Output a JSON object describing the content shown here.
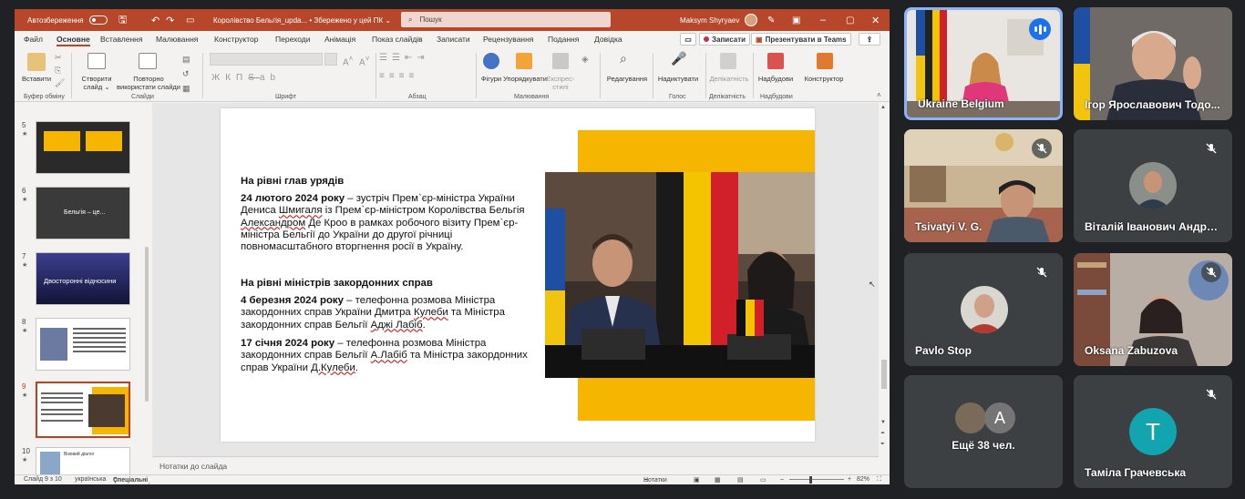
{
  "titlebar": {
    "autosave_label": "Автозбереження",
    "doc_title": "Королівство Бельгія_upda... • Збережено у цей ПК ⌄",
    "search_placeholder": "Пошук",
    "user_name": "Maksym Shyryaev"
  },
  "menu": {
    "tabs": [
      "Файл",
      "Основне",
      "Вставлення",
      "Малювання",
      "Конструктор",
      "Переходи",
      "Анімація",
      "Показ слайдів",
      "Записати",
      "Рецензування",
      "Подання",
      "Довідка"
    ],
    "active_tab": "Основне",
    "record_button": "Записати",
    "teams_button": "Презентувати в Teams"
  },
  "ribbon": {
    "paste": "Вставити",
    "new_slide": "Створити слайд ⌄",
    "reuse_slides": "Повторно використати слайди",
    "shapes": "Фігури",
    "arrange": "Упорядкувати",
    "quick_styles": "Експрес-стилі",
    "editing": "Редагування",
    "dictate": "Надиктувати",
    "sensitivity": "Делікатність",
    "add_ins": "Надбудови",
    "designer": "Конструктор",
    "groups": [
      "Буфер обміну",
      "Слайди",
      "Шрифт",
      "Абзац",
      "Малювання",
      "Голос",
      "Делікатність",
      "Надбудови"
    ]
  },
  "thumbnails": [
    {
      "num": "5",
      "star": "★"
    },
    {
      "num": "6",
      "star": "★",
      "caption": "Бельгія – це..."
    },
    {
      "num": "7",
      "star": "★",
      "caption": "Двосторонні відносини"
    },
    {
      "num": "8",
      "star": "★"
    },
    {
      "num": "9",
      "star": "★"
    },
    {
      "num": "10",
      "star": "★",
      "caption": "Візовий діалог"
    }
  ],
  "slide": {
    "heading1": "На рівні глав урядів",
    "para1_bold": "24 лютого 2024 року",
    "para1_a": " – зустріч Прем`єр-міністра України ",
    "para1_b": "Дениса ",
    "para1_c": "Шмигаля",
    "para1_d": " із Прем`єр-міністром Королівства Бельгія ",
    "para1_e": "Александром",
    "para1_f": " Де Кроо в рамках робочого візиту Прем`єр-міністра Бельгії до України до другої річниці повномасштабного вторгнення росії в Україну.",
    "heading2": "На рівні міністрів закордонних справ",
    "para2_bold": "4 березня 2024 року",
    "para2_a": " – телефонна розмова Міністра закордонних справ України Дмитра ",
    "para2_b": "Кулеби",
    "para2_c": " та Міністра закордонних справ Бельгії ",
    "para2_d": "Аджі Лабіб",
    "para2_e": ".",
    "para3_bold": "17 січня 2024 року",
    "para3_a": " – телефонна розмова Міністра закордонних справ Бельгії ",
    "para3_b": "А.Лабіб",
    "para3_c": " та Міністра закордонних справ України ",
    "para3_d": "Д.Кулеби",
    "para3_e": "."
  },
  "notes_placeholder": "Нотатки до слайда",
  "status": {
    "slide_counter": "Слайд 9 з 10",
    "language": "українська",
    "accessibility": "Спеціальні можливості: щось не так",
    "notes_btn": "Нотатки",
    "zoom": "82%"
  },
  "participants": [
    {
      "name": "Ukraine Belgium",
      "speaking": true
    },
    {
      "name": "Ігор Ярославович Тодо...",
      "muted": false
    },
    {
      "name": "Tsivatyi V. G.",
      "muted": true
    },
    {
      "name": "Віталій Іванович Андре...",
      "muted": true
    },
    {
      "name": "Pavlo Stop",
      "muted": true
    },
    {
      "name": "Oksana Zabuzova",
      "muted": true
    },
    {
      "name": "Ещё 38 чел.",
      "initial": "A"
    },
    {
      "name": "Таміла Грачевська",
      "muted": true,
      "initial": "T"
    }
  ],
  "colors": {
    "ppt_accent": "#b7472a",
    "slide_yellow": "#f6b500",
    "tile_bg": "#3c4043",
    "speaking_blue": "#1a73e8",
    "teal_avatar": "#12a4af"
  }
}
